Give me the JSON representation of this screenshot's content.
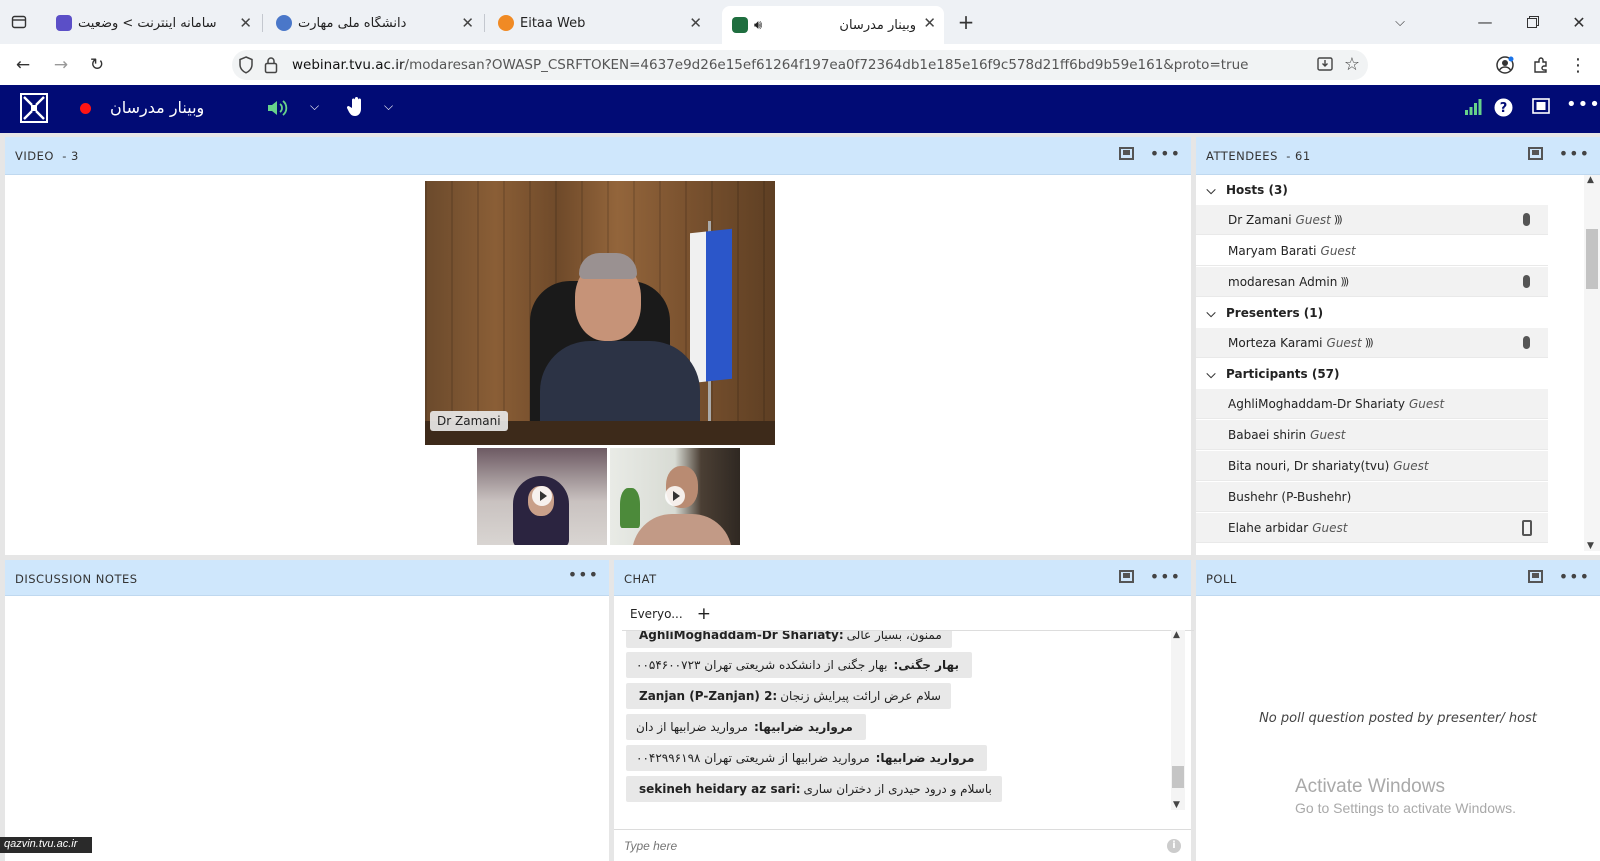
{
  "browser": {
    "tabs": [
      {
        "label": "سامانه اینترنت > وضعیت",
        "active": false
      },
      {
        "label": "دانشگاه ملی مهارت",
        "active": false
      },
      {
        "label": "Eitaa Web",
        "active": false
      },
      {
        "label": "وبینار مدرسان",
        "active": true
      }
    ],
    "new_tab_glyph": "+",
    "url_domain": "webinar.tvu.ac.ir",
    "url_path": "/modaresan?OWASP_CSRFTOKEN=4637e9d26e15ef61264f197ea0f72364db1e185e16f9c578d21ff6bd9b59e161&proto=true"
  },
  "app": {
    "title": "وبینار مدرسان",
    "accent_color": "#010b75",
    "record_color": "#ff1414"
  },
  "video_pod": {
    "title": "VIDEO",
    "count": "- 3",
    "main_speaker": "Dr Zamani"
  },
  "attendees_pod": {
    "title": "ATTENDEES",
    "count": "- 61",
    "groups": [
      {
        "label": "Hosts (3)",
        "members": [
          {
            "name": "Dr Zamani",
            "role": "Guest",
            "speaking": true,
            "device": "mic"
          },
          {
            "name": "Maryam Barati",
            "role": "Guest",
            "speaking": false,
            "device": ""
          },
          {
            "name": "modaresan Admin",
            "role": "",
            "speaking": true,
            "device": "mic"
          }
        ]
      },
      {
        "label": "Presenters (1)",
        "members": [
          {
            "name": "Morteza Karami",
            "role": "Guest",
            "speaking": true,
            "device": "mic"
          }
        ]
      },
      {
        "label": "Participants (57)",
        "members": [
          {
            "name": "AghliMoghaddam-Dr Shariaty",
            "role": "Guest",
            "speaking": false,
            "device": ""
          },
          {
            "name": "Babaei shirin",
            "role": "Guest",
            "speaking": false,
            "device": ""
          },
          {
            "name": "Bita nouri, Dr shariaty(tvu)",
            "role": "Guest",
            "speaking": false,
            "device": ""
          },
          {
            "name": "Bushehr (P-Bushehr)",
            "role": "",
            "speaking": false,
            "device": ""
          },
          {
            "name": "Elahe arbidar",
            "role": "Guest",
            "speaking": false,
            "device": "phone"
          }
        ]
      }
    ]
  },
  "notes_pod": {
    "title": "DISCUSSION NOTES"
  },
  "chat_pod": {
    "title": "CHAT",
    "tab_label": "Everyo...",
    "add_tab_glyph": "+",
    "messages": [
      {
        "sender": "AghliMoghaddam-Dr Shariaty:",
        "text": "ممنون، بسیار عالی"
      },
      {
        "sender": "بهار جگنی:",
        "text": "بهار جگنی از دانشکده شریعتی تهران ۰۰۵۴۶۰۰۷۲۳"
      },
      {
        "sender": "Zanjan (P-Zanjan) 2:",
        "text": "سلام عرض ارائت پیرایش زنجان"
      },
      {
        "sender": "مروارید ضرابیها:",
        "text": "مروارید ضرابیها از دان"
      },
      {
        "sender": "مروارید ضرابیها:",
        "text": "مروارید ضرابیها از شریعتی تهران ۰۰۴۲۹۹۶۱۹۸"
      },
      {
        "sender": "sekineh heidary az sari:",
        "text": "باسلام و درود حیدری از دختران ساری"
      }
    ],
    "input_placeholder": "Type here"
  },
  "poll_pod": {
    "title": "POLL",
    "empty_message": "No poll question posted by presenter/ host"
  },
  "os_watermark": {
    "line1": "Activate Windows",
    "line2": "Go to Settings to activate Windows."
  },
  "credit": "qazvin.tvu.ac.ir"
}
